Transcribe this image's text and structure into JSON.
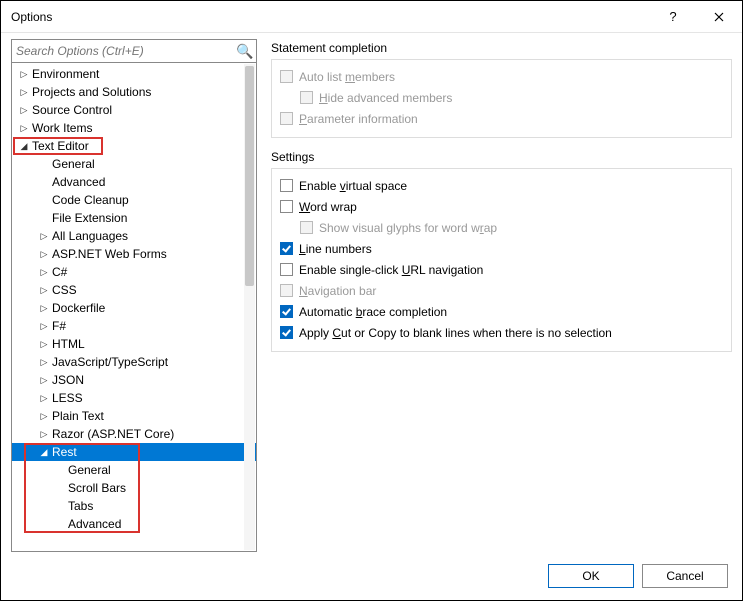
{
  "window": {
    "title": "Options"
  },
  "search": {
    "placeholder": "Search Options (Ctrl+E)"
  },
  "tree": {
    "environment": "Environment",
    "projects": "Projects and Solutions",
    "sourceControl": "Source Control",
    "workItems": "Work Items",
    "textEditor": "Text Editor",
    "teGeneral": "General",
    "teAdvanced": "Advanced",
    "teCodeCleanup": "Code Cleanup",
    "teFileExt": "File Extension",
    "teAllLang": "All Languages",
    "teAspWeb": "ASP.NET Web Forms",
    "teCSharp": "C#",
    "teCSS": "CSS",
    "teDocker": "Dockerfile",
    "teFSharp": "F#",
    "teHTML": "HTML",
    "teJSTS": "JavaScript/TypeScript",
    "teJSON": "JSON",
    "teLESS": "LESS",
    "tePlain": "Plain Text",
    "teRazor": "Razor (ASP.NET Core)",
    "teRest": "Rest",
    "restGeneral": "General",
    "restScroll": "Scroll Bars",
    "restTabs": "Tabs",
    "restAdvanced": "Advanced"
  },
  "panel": {
    "stmtGroup": "Statement completion",
    "autoList_pre": "Auto list ",
    "autoList_u": "m",
    "autoList_post": "embers",
    "hideAdv_u": "H",
    "hideAdv_post": "ide advanced members",
    "paramInfo_u": "P",
    "paramInfo_post": "arameter information",
    "settingsGroup": "Settings",
    "virtSpace_pre": "Enable ",
    "virtSpace_u": "v",
    "virtSpace_post": "irtual space",
    "wordWrap_u": "W",
    "wordWrap_post": "ord wrap",
    "glyphs_pre": "Show visual glyphs for word w",
    "glyphs_u": "r",
    "glyphs_post": "ap",
    "lineNum_u": "L",
    "lineNum_post": "ine numbers",
    "singleClick_pre": "Enable single-click ",
    "singleClick_u": "U",
    "singleClick_post": "RL navigation",
    "navBar_u": "N",
    "navBar_post": "avigation bar",
    "brace_pre": "Automatic ",
    "brace_u": "b",
    "brace_post": "race completion",
    "blank_pre": "Apply ",
    "blank_u": "C",
    "blank_post": "ut or Copy to blank lines when there is no selection"
  },
  "footer": {
    "ok": "OK",
    "cancel": "Cancel"
  }
}
